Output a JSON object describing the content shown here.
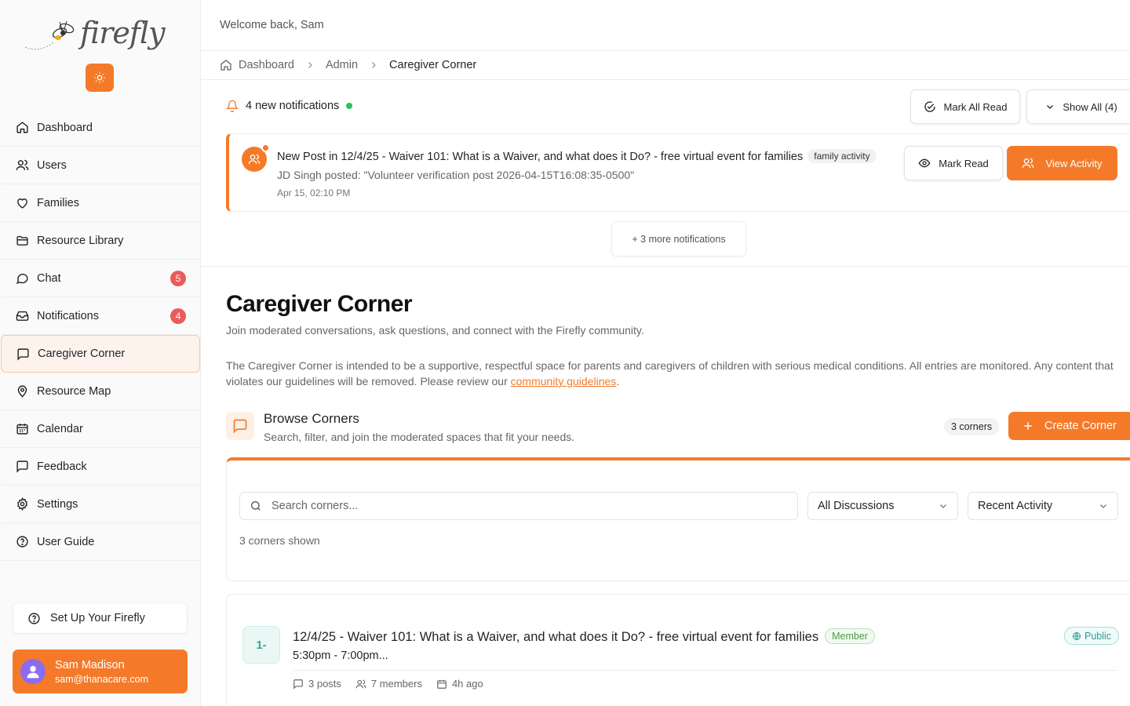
{
  "app": {
    "logo": "firefly"
  },
  "sidebar": {
    "items": [
      {
        "label": "Dashboard",
        "icon": "home-icon"
      },
      {
        "label": "Users",
        "icon": "users-icon"
      },
      {
        "label": "Families",
        "icon": "heart-icon"
      },
      {
        "label": "Resource Library",
        "icon": "folder-icon"
      },
      {
        "label": "Chat",
        "icon": "chat-icon",
        "badge": "5"
      },
      {
        "label": "Notifications",
        "icon": "inbox-icon",
        "badge": "4"
      },
      {
        "label": "Caregiver Corner",
        "icon": "message-square-icon",
        "active": true
      },
      {
        "label": "Resource Map",
        "icon": "map-pin-icon"
      },
      {
        "label": "Calendar",
        "icon": "calendar-icon"
      },
      {
        "label": "Feedback",
        "icon": "message-square-icon"
      },
      {
        "label": "Settings",
        "icon": "gear-icon"
      },
      {
        "label": "User Guide",
        "icon": "help-circle-icon"
      }
    ],
    "setup_label": "Set Up Your Firefly",
    "user": {
      "name": "Sam Madison",
      "email": "sam@thanacare.com"
    }
  },
  "header": {
    "welcome": "Welcome back, Sam"
  },
  "breadcrumb": {
    "items": [
      "Dashboard",
      "Admin",
      "Caregiver Corner"
    ]
  },
  "notifications": {
    "count_label": "4 new notifications",
    "mark_all_label": "Mark All Read",
    "show_all_label": "Show All (4)",
    "item": {
      "title": "New Post in 12/4/25 - Waiver 101: What is a Waiver, and what does it Do? - free virtual event for families",
      "tag": "family activity",
      "body": "JD Singh posted: \"Volunteer verification post 2026-04-15T16:08:35-0500\"",
      "time": "Apr 15, 02:10 PM",
      "mark_read_label": "Mark Read",
      "view_label": "View Activity"
    },
    "more_label": "+ 3 more notifications"
  },
  "page": {
    "title": "Caregiver Corner",
    "subtitle": "Join moderated conversations, ask questions, and connect with the Firefly community.",
    "description": "The Caregiver Corner is intended to be a supportive, respectful space for parents and caregivers of children with serious medical conditions. All entries are monitored. Any content that violates our guidelines will be removed. Please review our ",
    "guidelines_link": "community guidelines",
    "description_end": "."
  },
  "browse": {
    "title": "Browse Corners",
    "subtitle": "Search, filter, and join the moderated spaces that fit your needs.",
    "count": "3 corners",
    "create_label": "Create Corner",
    "search_placeholder": "Search corners...",
    "filter_selected": "All Discussions",
    "sort_selected": "Recent Activity",
    "shown_label": "3 corners shown"
  },
  "corners": [
    {
      "num": "1-",
      "title": "12/4/25 - Waiver 101: What is a Waiver, and what does it Do? - free virtual event for families",
      "role": "Member",
      "visibility": "Public",
      "time": "5:30pm - 7:00pm...",
      "posts": "3 posts",
      "members": "7 members",
      "updated": "4h ago"
    }
  ],
  "colors": {
    "accent": "#f47a2a",
    "badge": "#ec5b5b",
    "online": "#22c55e",
    "public": "#2c9b93",
    "member": "#4f9b4a"
  }
}
